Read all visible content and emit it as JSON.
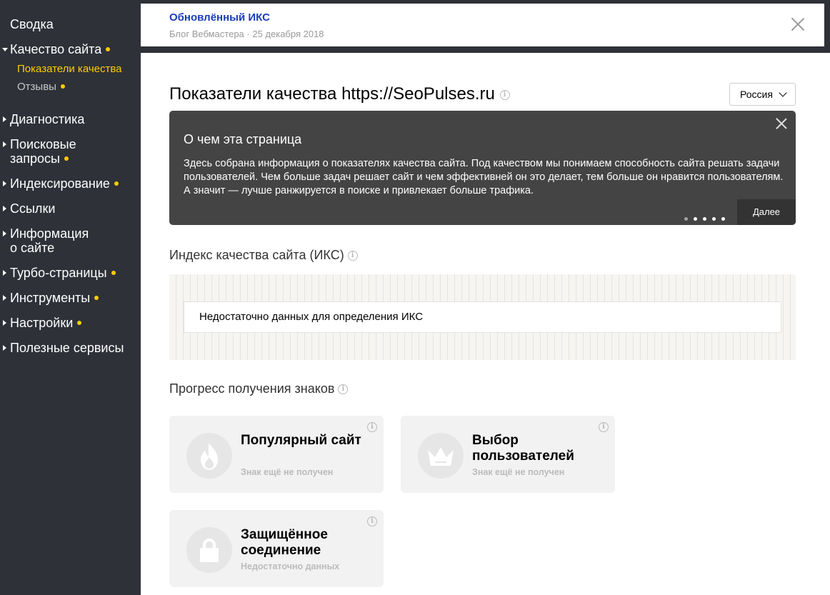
{
  "sidebar": {
    "items": [
      {
        "label": "Сводка"
      },
      {
        "label": "Качество сайта"
      },
      {
        "label": "Диагностика"
      },
      {
        "label": "Поисковые",
        "label2": "запросы"
      },
      {
        "label": "Индексирование"
      },
      {
        "label": "Ссылки"
      },
      {
        "label": "Информация",
        "label2": "о сайте"
      },
      {
        "label": "Турбо-страницы"
      },
      {
        "label": "Инструменты"
      },
      {
        "label": "Настройки"
      },
      {
        "label": "Полезные сервисы"
      }
    ],
    "subitems": [
      {
        "label": "Показатели качества"
      },
      {
        "label": "Отзывы"
      }
    ]
  },
  "notice": {
    "title": "Обновлённый ИКС",
    "meta": "Блог Вебмастера · 25 декабря 2018"
  },
  "main": {
    "page_title": "Показатели качества https://SeoPulses.ru",
    "region": "Россия",
    "onboarding": {
      "title": "О чем эта страница",
      "text": "Здесь собрана информация о показателях качества сайта. Под качеством мы понимаем способность сайта решать задачи пользователей. Чем больше задач решает сайт и чем эффективней он это делает, тем больше он нравится пользователям. А значит — лучше ранжируется в поиске и привлекает больше трафика.",
      "next_label": "Далее"
    },
    "iks": {
      "title": "Индекс качества сайта (ИКС)",
      "message": "Недостаточно данных для определения ИКС"
    },
    "badges_section": {
      "title": "Прогресс получения знаков",
      "badges": [
        {
          "name": "Популярный сайт",
          "status": "Знак ещё не получен",
          "icon": "flame-icon"
        },
        {
          "name": "Выбор пользователей",
          "status": "Знак ещё не получен",
          "icon": "crown-icon"
        },
        {
          "name": "Защищённое соединение",
          "status": "Недостаточно данных",
          "icon": "lock-icon"
        }
      ]
    }
  },
  "colors": {
    "sidebar_bg": "#2e3138",
    "accent_dot": "#ffcc00",
    "link": "#1a3dba",
    "onboarding_bg": "#444444"
  }
}
